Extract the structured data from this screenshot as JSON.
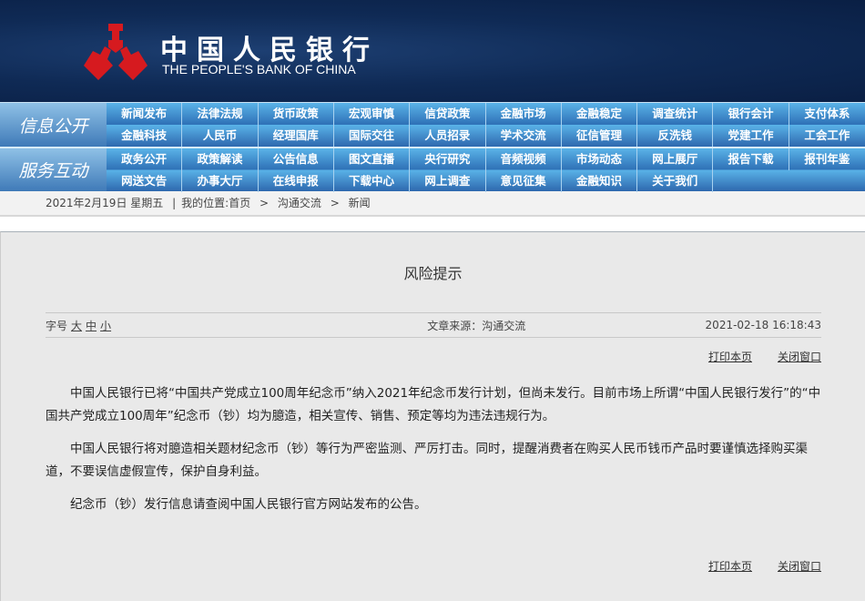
{
  "header": {
    "title_cn": "中国人民银行",
    "title_en": "THE PEOPLE'S BANK OF CHINA"
  },
  "nav": [
    {
      "label": "信息公开",
      "items": [
        "新闻发布",
        "法律法规",
        "货币政策",
        "宏观审慎",
        "信贷政策",
        "金融市场",
        "金融稳定",
        "调查统计",
        "银行会计",
        "支付体系",
        "金融科技",
        "人民币",
        "经理国库",
        "国际交往",
        "人员招录",
        "学术交流",
        "征信管理",
        "反洗钱",
        "党建工作",
        "工会工作"
      ]
    },
    {
      "label": "服务互动",
      "items": [
        "政务公开",
        "政策解读",
        "公告信息",
        "图文直播",
        "央行研究",
        "音频视频",
        "市场动态",
        "网上展厅",
        "报告下载",
        "报刊年鉴",
        "网送文告",
        "办事大厅",
        "在线申报",
        "下载中心",
        "网上调查",
        "意见征集",
        "金融知识",
        "关于我们",
        "",
        ""
      ]
    }
  ],
  "breadcrumb": {
    "date": "2021年2月19日 星期五",
    "sep": "|",
    "location_label": "我的位置:",
    "items": [
      "首页",
      "沟通交流",
      "新闻"
    ],
    "arrow": ">"
  },
  "article": {
    "title": "风险提示",
    "font_size_label": "字号",
    "font_sizes": [
      "大",
      "中",
      "小"
    ],
    "source": "文章来源：沟通交流",
    "datetime": "2021-02-18 16:18:43",
    "print": "打印本页",
    "close": "关闭窗口",
    "paragraphs": [
      "中国人民银行已将“中国共产党成立100周年纪念币”纳入2021年纪念币发行计划，但尚未发行。目前市场上所谓“中国人民银行发行”的“中国共产党成立100周年”纪念币（钞）均为臆造，相关宣传、销售、预定等均为违法违规行为。",
      "中国人民银行将对臆造相关题材纪念币（钞）等行为严密监测、严厉打击。同时，提醒消费者在购买人民币钱币产品时要谨慎选择购买渠道，不要误信虚假宣传，保护自身利益。",
      "纪念币（钞）发行信息请查阅中国人民银行官方网站发布的公告。"
    ]
  }
}
